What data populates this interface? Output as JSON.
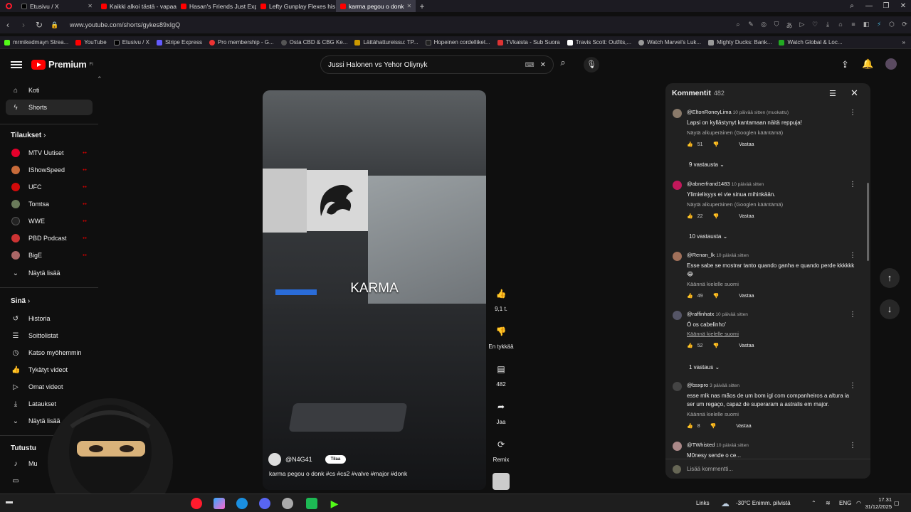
{
  "browser": {
    "tabs": [
      {
        "label": "Etusivu / X",
        "color": "#000000"
      },
      {
        "label": "Kaikki alkoi tästä - vapaa",
        "color": "#ff0000"
      },
      {
        "label": "Hasan's Friends Just Expo",
        "color": "#ff0000"
      },
      {
        "label": "Lefty Gunplay Flexes his C",
        "color": "#ff0000"
      },
      {
        "label": "karma pegou o donk",
        "color": "#ff0000"
      }
    ],
    "url": "www.youtube.com/shorts/gykes89xIgQ",
    "bookmarks": [
      {
        "label": "mrmikedmayn Strea...",
        "color": "#53fc18"
      },
      {
        "label": "YouTube",
        "color": "#ff0000"
      },
      {
        "label": "Etusivu / X",
        "color": "#000000"
      },
      {
        "label": "Stripe Express",
        "color": "#635bff"
      },
      {
        "label": "Pro membership - G...",
        "color": "#e33"
      },
      {
        "label": "Osta CBD & CBG Ke...",
        "color": "#555"
      },
      {
        "label": "NT",
        "color": "#222"
      },
      {
        "label": "Hopeinen cordelliket...",
        "color": "#888"
      },
      {
        "label": "TVkaista - Sub Suora",
        "color": "#d33"
      },
      {
        "label": "Travis Scott: Outfits,...",
        "color": "#fff"
      },
      {
        "label": "Watch Marvel's Luk...",
        "color": "#999"
      },
      {
        "label": "Mighty Ducks: Bank...",
        "color": "#999"
      },
      {
        "label": "Watch Global & Loc...",
        "color": "#2a2"
      }
    ],
    "bookmark_prefix": "Lättähattureissu: TP..."
  },
  "header": {
    "logo": "Premium",
    "logo_sup": "FI",
    "search_value": "Jussi Halonen vs Yehor Oliynyk"
  },
  "sidebar": {
    "main": [
      {
        "label": "Koti",
        "icon": "home-icon"
      },
      {
        "label": "Shorts",
        "icon": "shorts-icon"
      }
    ],
    "subs_title": "Tilaukset",
    "subs": [
      {
        "label": "MTV Uutiset",
        "color": "#e4002b"
      },
      {
        "label": "IShowSpeed",
        "color": "#c86b3a"
      },
      {
        "label": "UFC",
        "color": "#d20a0a"
      },
      {
        "label": "Tomtsa",
        "color": "#6a7a5a"
      },
      {
        "label": "WWE",
        "color": "#222"
      },
      {
        "label": "PBD Podcast",
        "color": "#c33"
      },
      {
        "label": "BigE",
        "color": "#a66"
      }
    ],
    "show_more": "Näytä lisää",
    "you_title": "Sinä",
    "you": [
      {
        "label": "Historia"
      },
      {
        "label": "Soittolistat"
      },
      {
        "label": "Katso myöhemmin"
      },
      {
        "label": "Tykätyt videot"
      },
      {
        "label": "Omat videot"
      },
      {
        "label": "Lataukset"
      }
    ],
    "show_more2": "Näytä lisää",
    "explore_title": "Tutustu",
    "explore_item": "Mu"
  },
  "video": {
    "overlay_text": "KARMA",
    "channel": "@N4G41",
    "subscribe": "Tilaa",
    "title": "karma pegou o donk #cs #cs2 #valve #major #donk"
  },
  "actions": {
    "likes": "9,1 t.",
    "dislike": "En tykkää",
    "comments": "482",
    "share": "Jaa",
    "remix": "Remix"
  },
  "comments_panel": {
    "title": "Kommentit",
    "count": "482",
    "input_placeholder": "Lisää kommentti...",
    "comments": [
      {
        "user": "@EltonRoneyLima",
        "time": "10 päivää sitten (muokattu)",
        "text": "Lapsi on kyllästynyt kantamaan näitä reppuja!",
        "translate": "Näytä alkuperäinen (Googlen kääntämä)",
        "likes": "51",
        "reply": "Vastaa",
        "replies": "9 vastausta",
        "color": "#8a7a6a"
      },
      {
        "user": "@abnerfrand1483",
        "time": "10 päivää sitten",
        "text": "Ylimielisyys ei vie sinua mihinkään.",
        "translate": "Näytä alkuperäinen (Googlen kääntämä)",
        "likes": "22",
        "reply": "Vastaa",
        "replies": "10 vastausta",
        "color": "#c2185b"
      },
      {
        "user": "@Renan_lk",
        "time": "10 päivää sitten",
        "text": "Esse sabe se mostrar tanto quando ganha e quando perde kkkkkk 😂",
        "translate": "Käännä kielelle suomi",
        "likes": "49",
        "reply": "Vastaa",
        "replies": "",
        "color": "#a0705a"
      },
      {
        "user": "@raffinhatx",
        "time": "10 päivää sitten",
        "text": "Ó os cabelinho'",
        "translate": "Käännä kielelle suomi",
        "likes": "52",
        "reply": "Vastaa",
        "replies": "1 vastaus",
        "color": "#556"
      },
      {
        "user": "@bsxpro",
        "time": "3 päivää sitten",
        "text": "esse mlk nas mãos de um bom igl com companheiros a altura ia ser um regaço, capaz de superaram a astralis em major.",
        "translate": "Käännä kielelle suomi",
        "likes": "8",
        "reply": "Vastaa",
        "replies": "",
        "color": "#444"
      },
      {
        "user": "@TWhisted",
        "time": "10 päivää sitten",
        "text": "M0nesy sende o ce...",
        "translate": "",
        "likes": "",
        "reply": "",
        "replies": "",
        "color": "#a88"
      }
    ]
  },
  "taskbar": {
    "links": "Links",
    "weather": "-30°C  Enimm. pilvistä",
    "lang": "ENG",
    "time": "17.31",
    "date": "31/12/2025"
  }
}
